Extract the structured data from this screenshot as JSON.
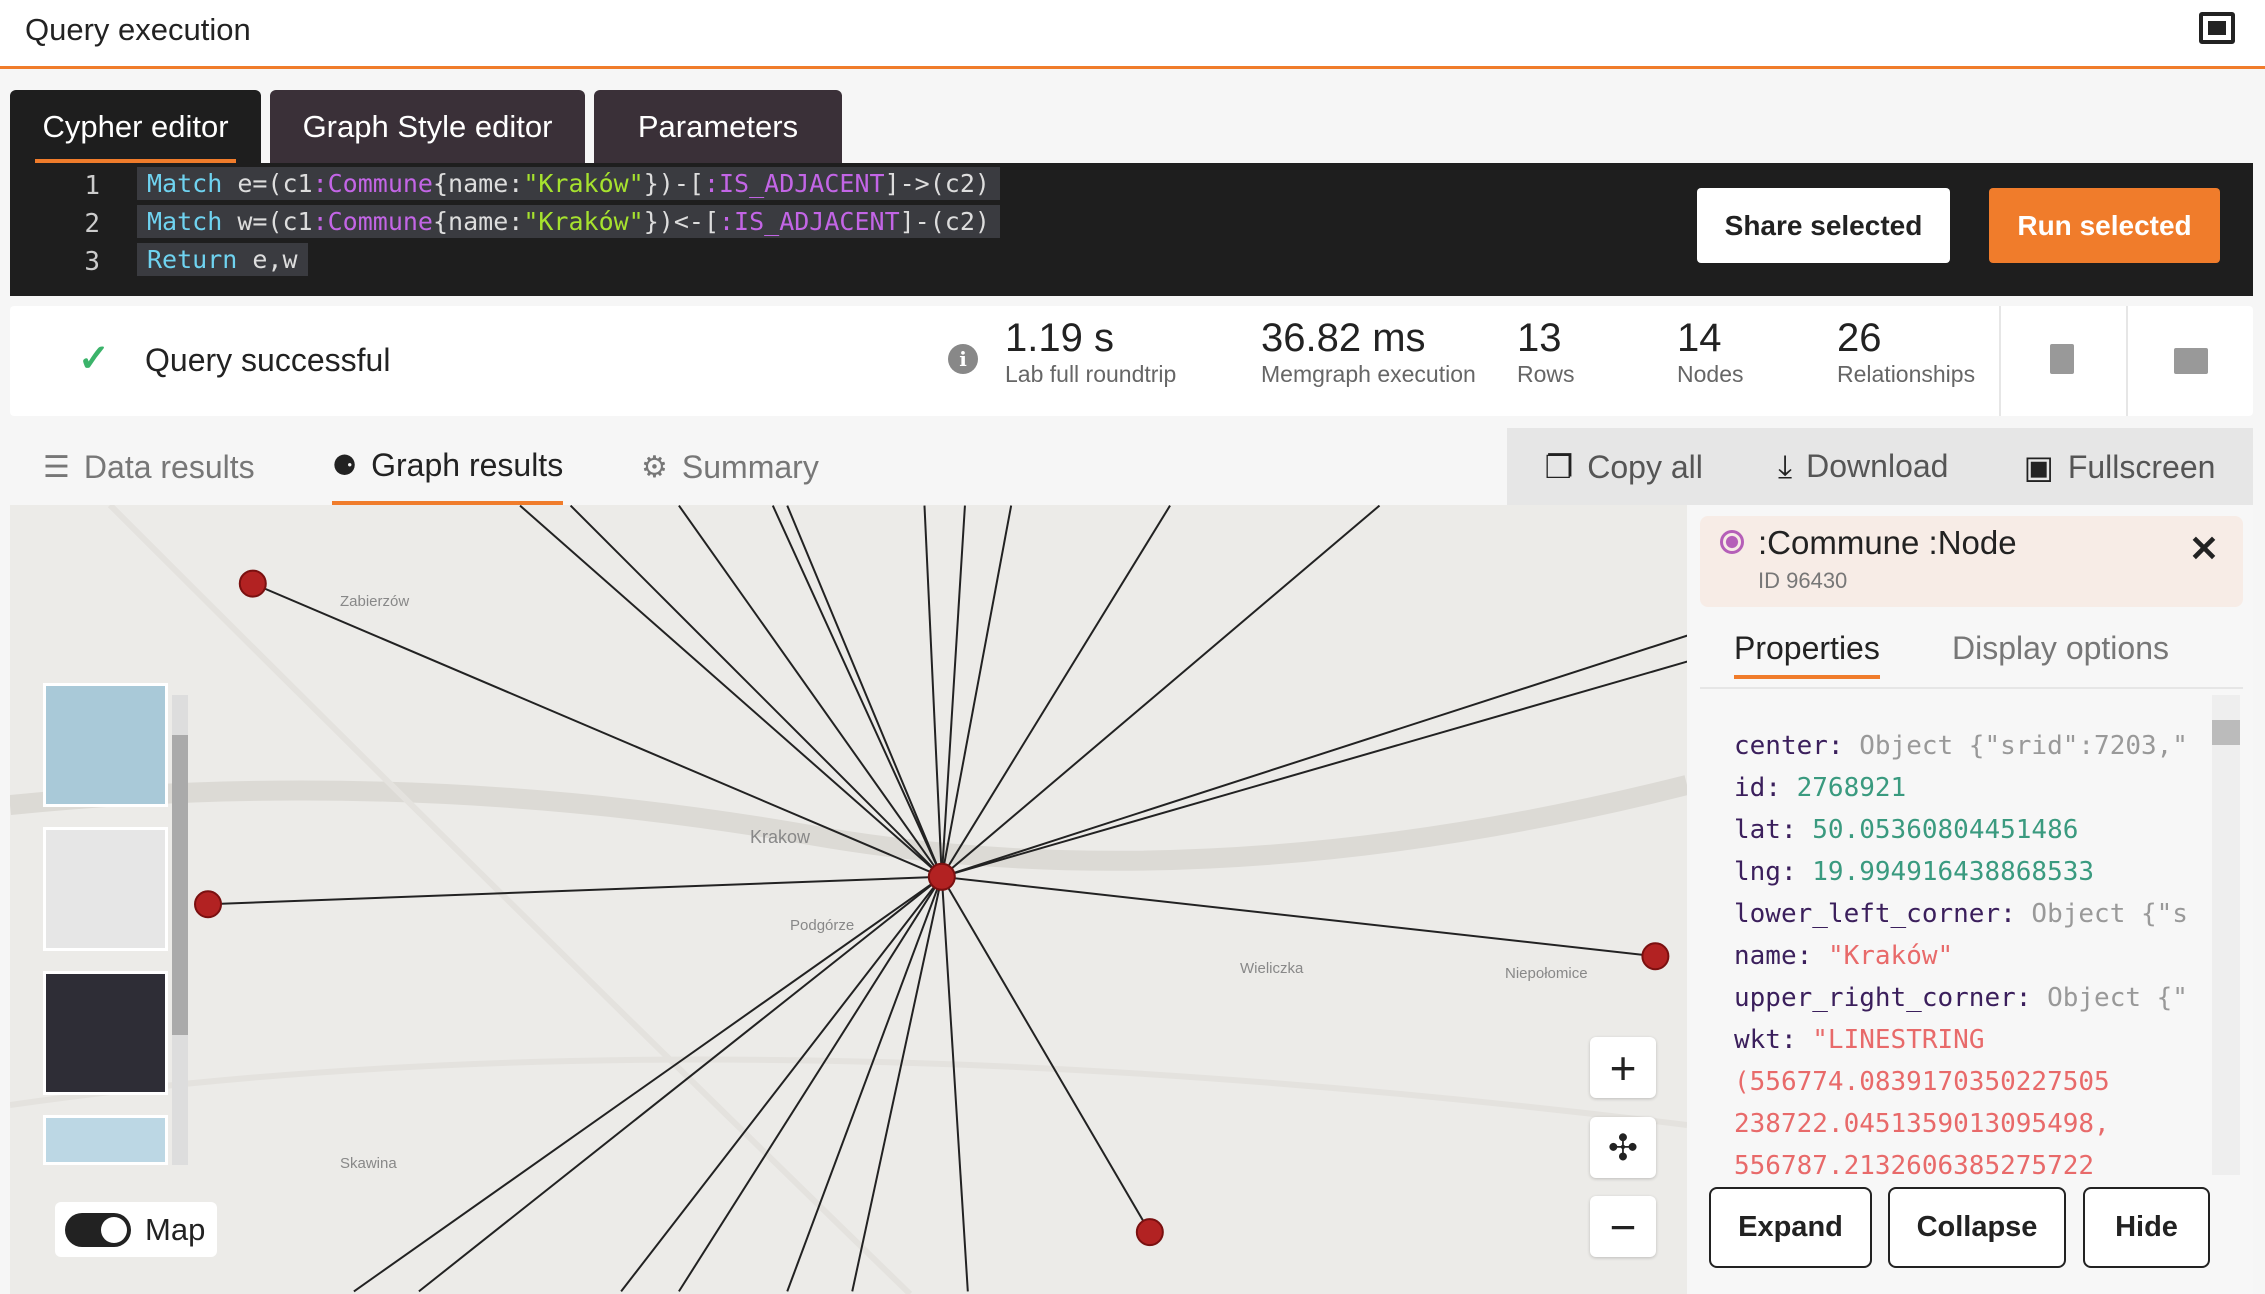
{
  "header": {
    "title": "Query execution"
  },
  "editor": {
    "tabs": [
      "Cypher editor",
      "Graph Style editor",
      "Parameters"
    ],
    "lines": [
      {
        "num": "1",
        "parts": [
          "Match",
          " e=(c1",
          ":Commune",
          "{name:",
          "\"Kraków\"",
          "})-[",
          ":IS_ADJACENT",
          "]->(c2)"
        ]
      },
      {
        "num": "2",
        "parts": [
          "Match",
          " w=(c1",
          ":Commune",
          "{name:",
          "\"Kraków\"",
          "})<-[",
          ":IS_ADJACENT",
          "]-(c2)"
        ]
      },
      {
        "num": "3",
        "parts": [
          "Return",
          " e,w"
        ]
      }
    ],
    "share_label": "Share selected",
    "run_label": "Run selected",
    "accent": "#f07c2b"
  },
  "status": {
    "message": "Query successful",
    "stats": [
      {
        "value": "1.19 s",
        "label": "Lab full roundtrip"
      },
      {
        "value": "36.82 ms",
        "label": "Memgraph execution"
      },
      {
        "value": "13",
        "label": "Rows"
      },
      {
        "value": "14",
        "label": "Nodes"
      },
      {
        "value": "26",
        "label": "Relationships"
      }
    ]
  },
  "results": {
    "tabs": [
      "Data results",
      "Graph results",
      "Summary"
    ],
    "toolbar": [
      "Copy all",
      "Download",
      "Fullscreen"
    ]
  },
  "map": {
    "toggle_label": "Map",
    "labels": [
      "Krakow",
      "Podgórze",
      "Zabierzów",
      "Wieliczka",
      "Niepołomice",
      "Skawina"
    ]
  },
  "panel": {
    "title": ":Commune :Node",
    "id": "ID 96430",
    "tabs": [
      "Properties",
      "Display options"
    ],
    "properties": [
      {
        "key": "center",
        "value": "Object {\"srid\":7203,\"",
        "type": "o"
      },
      {
        "key": "id",
        "value": "2768921",
        "type": "n"
      },
      {
        "key": "lat",
        "value": "50.05360804451486",
        "type": "n"
      },
      {
        "key": "lng",
        "value": "19.994916438868533",
        "type": "n"
      },
      {
        "key": "lower_left_corner",
        "value": "Object {\"s",
        "type": "o"
      },
      {
        "key": "name",
        "value": "\"Kraków\"",
        "type": "s"
      },
      {
        "key": "upper_right_corner",
        "value": "Object {\"",
        "type": "o"
      },
      {
        "key": "wkt",
        "value": "\"LINESTRING",
        "type": "s"
      }
    ],
    "wkt_cont": [
      "(556774.0839170350227505",
      "238722.0451359013095498,",
      "556787.2132606385275722"
    ],
    "buttons": [
      "Expand",
      "Collapse",
      "Hide"
    ]
  }
}
